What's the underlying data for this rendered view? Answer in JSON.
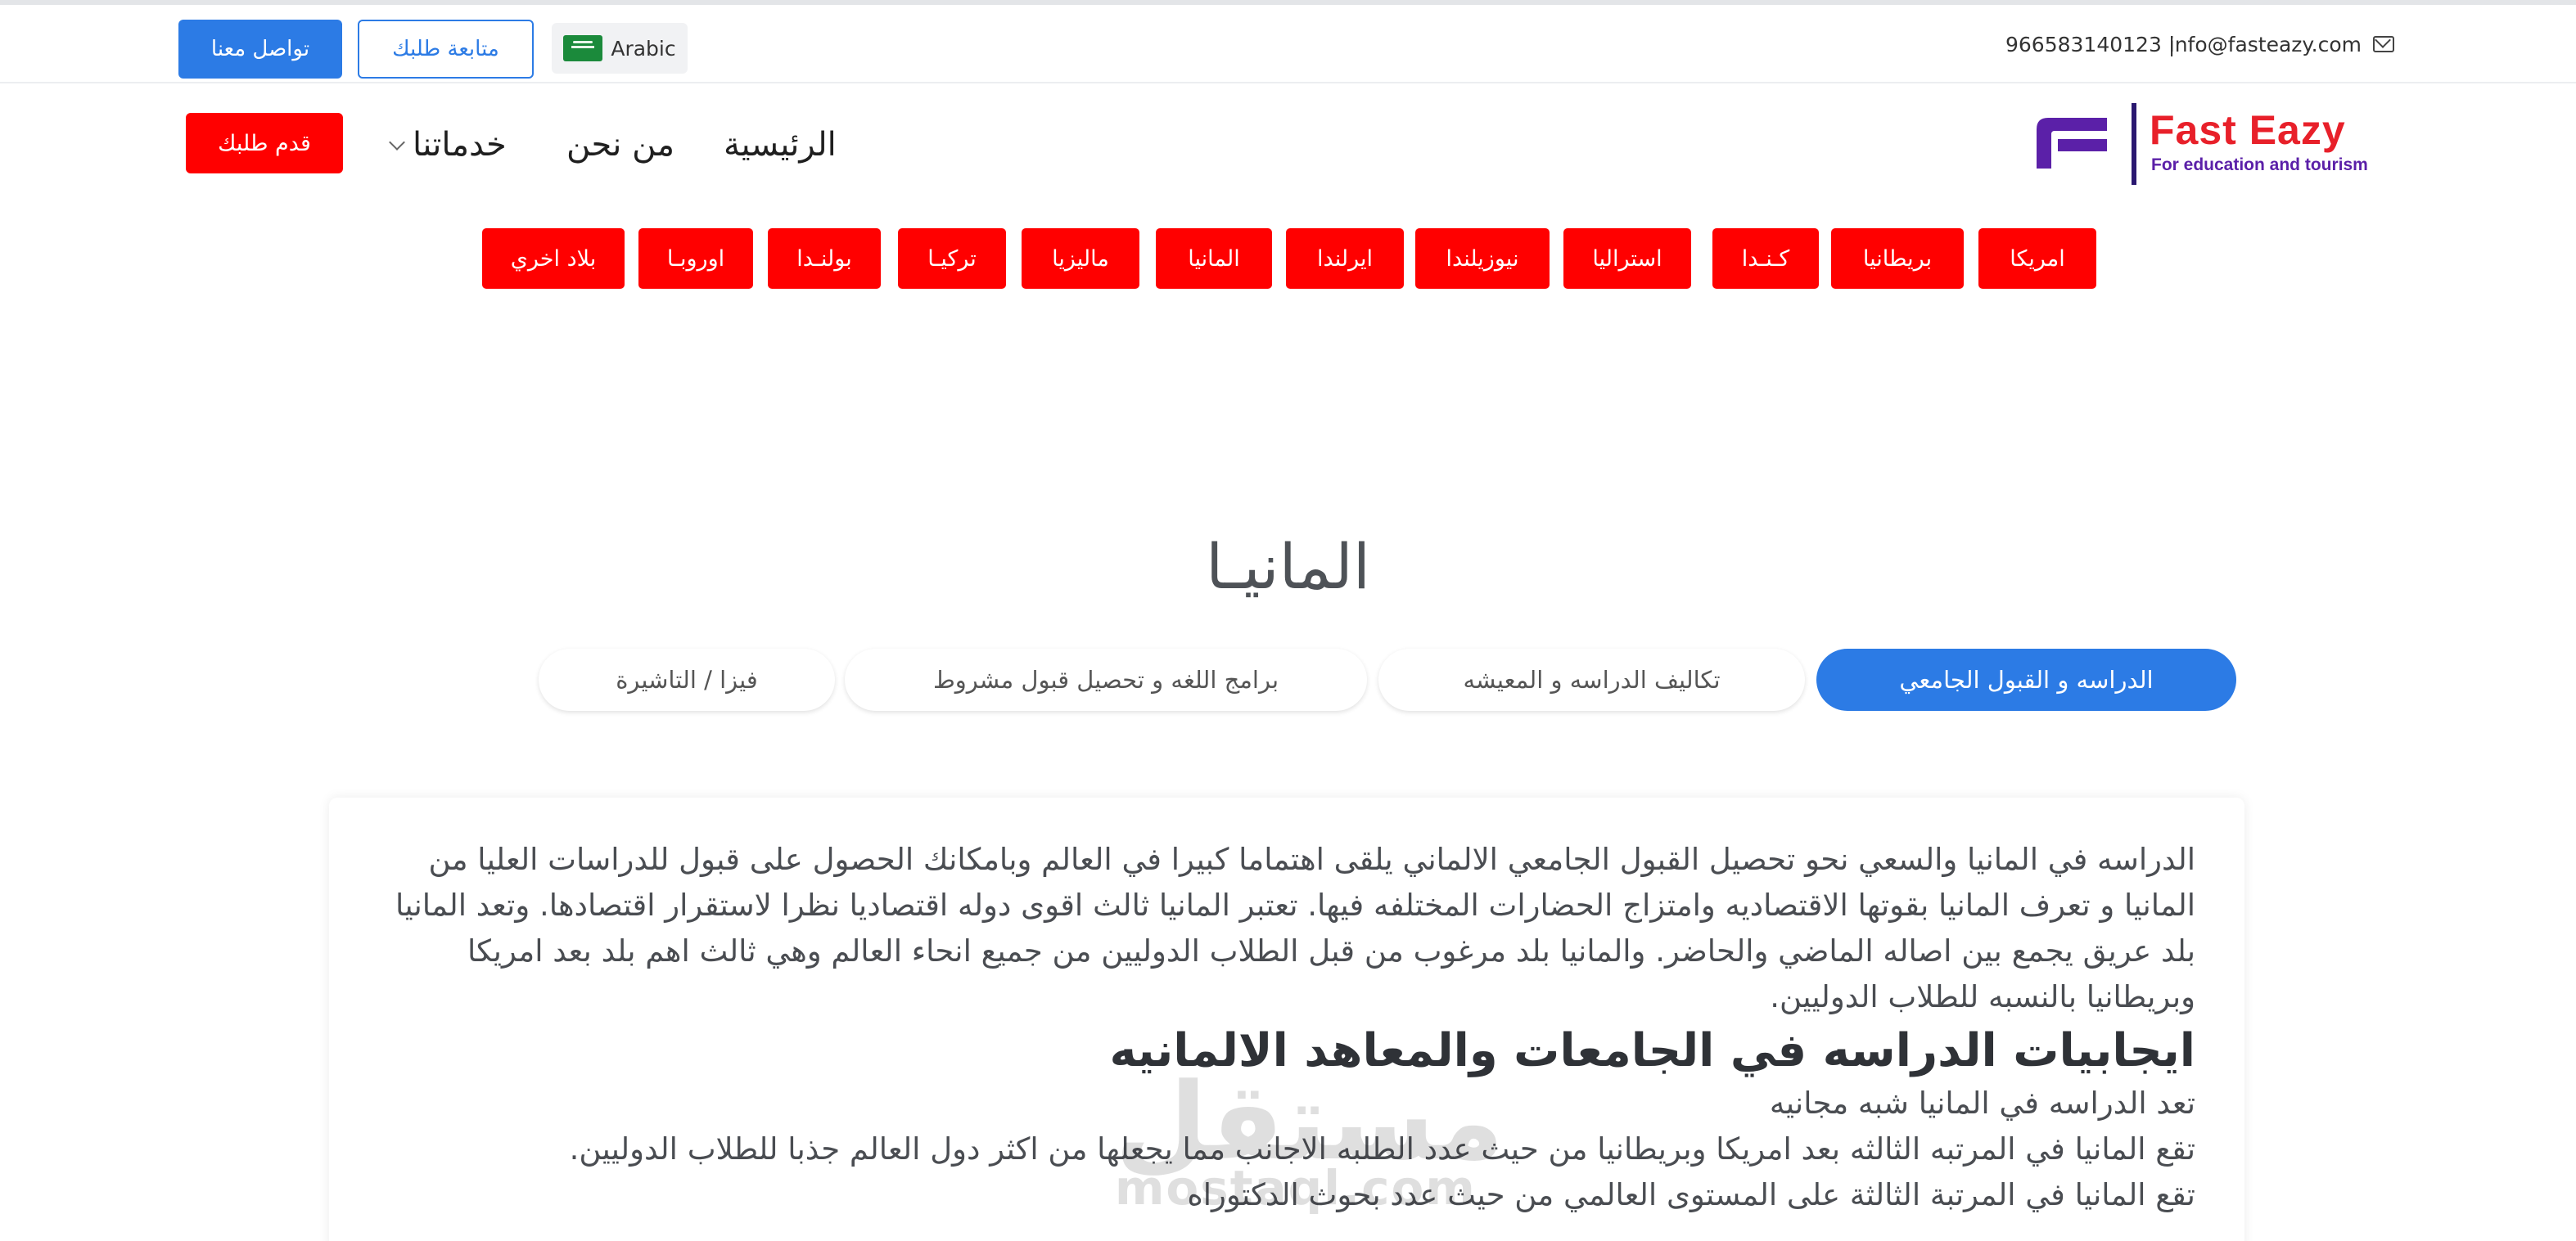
{
  "topbar": {
    "email": "info@fasteazy.com",
    "phone": "966583140123 |",
    "contact_button": "تواصل معنا",
    "track_button": "متابعة طلبك",
    "language": "Arabic"
  },
  "logo": {
    "title": "Fast Eazy",
    "subtitle": "For education and tourism"
  },
  "nav": {
    "home": "الرئيسية",
    "about": "من نحن",
    "services": "خدماتنا",
    "apply_button": "قدم طلبك"
  },
  "countries": [
    "امريكا",
    "بريطانيا",
    "كـنـدا",
    "استراليا",
    "نيوزيلندا",
    "ايرلندا",
    "المانيا",
    "ماليزيا",
    "تركيـا",
    "بولنـدا",
    "اوروبـا",
    "بلاد اخري"
  ],
  "page": {
    "title": "المانيـا"
  },
  "tabs": [
    {
      "label": "الدراسه و القبول الجامعي",
      "active": true
    },
    {
      "label": "تكاليف الدراسه و المعيشه",
      "active": false
    },
    {
      "label": "برامج اللغه و تحصيل قبول مشروط",
      "active": false
    },
    {
      "label": "فيزا / التاشيرة",
      "active": false
    }
  ],
  "content": {
    "paragraph": "الدراسه في المانيا والسعي نحو تحصيل القبول الجامعي الالماني يلقى اهتماما كبيرا في العالم وبامكانك الحصول على قبول للدراسات العليا من المانيا و تعرف المانيا بقوتها الاقتصاديه وامتزاج الحضارات المختلفه فيها. تعتبر المانيا ثالث اقوى دوله اقتصاديا نظرا لاستقرار اقتصادها. وتعد المانيا بلد عريق يجمع بين اصاله الماضي والحاضر. والمانيا بلد مرغوب من قبل الطلاب الدوليين من جميع انحاء العالم وهي ثالث اهم بلد بعد امريكا وبريطانيا بالنسبه للطلاب الدوليين.",
    "heading": "ايجابيات الدراسه في الجامعات والمعاهد الالمانيه",
    "line1": "تعد الدراسه في المانيا شبه مجانيه",
    "line2": "تقع المانيا في المرتبه الثالثه بعد امريكا وبريطانيا من حيث عدد الطلبه الاجانب مما يجعلها من اكثر دول العالم جذبا للطلاب الدوليين.",
    "line3": "تقع المانيا في المرتبة الثالثة على المستوى العالمي من حيث عدد بحوث الدكتوراه"
  },
  "watermark": {
    "arabic": "مستقل",
    "latin": "mostaql.com"
  },
  "colors": {
    "primary_blue": "#2c7be5",
    "accent_red": "#ff0000",
    "logo_purple": "#5b20a8"
  }
}
